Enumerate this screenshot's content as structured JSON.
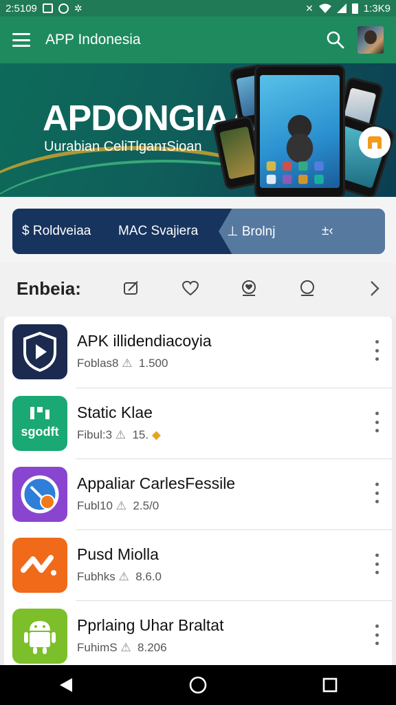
{
  "status_bar": {
    "time": "2:5109",
    "right_text": "1:3K9",
    "icons": [
      "notification-box-icon",
      "circle-app-icon",
      "settings-small-icon",
      "mute-icon",
      "wifi-icon",
      "signal-icon",
      "battery-icon"
    ]
  },
  "appbar": {
    "title": "APP Indonesia",
    "icons": [
      "menu-icon",
      "search-icon",
      "avatar"
    ]
  },
  "banner": {
    "title": "APDONGIAA",
    "subtitle": "Uurabian CeliTlganɪSioan",
    "colors": {
      "bg": "#0d6b5a",
      "accent": "#c9a331",
      "badge": "#f29b1d"
    }
  },
  "categories": {
    "items": [
      {
        "icon": "dollar-icon",
        "label": "Roldveiaa"
      },
      {
        "icon": "",
        "label": "MAC Svajiera"
      },
      {
        "icon": "download-icon",
        "label": "Brolnj"
      },
      {
        "icon": "shuffle-icon",
        "label": "±‹"
      }
    ],
    "active_index": 2,
    "colors": {
      "bg": "#17345e",
      "active": "#5679a0"
    }
  },
  "section": {
    "title": "Enbeia:",
    "icons": [
      "edit-icon",
      "heart-icon",
      "badge-heart-icon",
      "chat-icon",
      "chevron-right-icon"
    ]
  },
  "apps": [
    {
      "name": "APK illidendiacoyia",
      "meta": "Foblas8",
      "value": "1.500",
      "icon": "play-shield-icon",
      "color": "#1b2a4e"
    },
    {
      "name": "Static Klae",
      "meta": "Fibul:3",
      "value": "15.",
      "icon": "grid-green-icon",
      "color": "#1aa874"
    },
    {
      "name": "Appaliar CarlesFessile",
      "meta": "Fubl10",
      "value": "2.5/0",
      "icon": "compass-icon",
      "color": "#8a45d0"
    },
    {
      "name": "Pusd Miolla",
      "meta": "Fubhks",
      "value": "8.6.0",
      "icon": "wave-icon",
      "color": "#f06a1a"
    },
    {
      "name": "Pprlaing Uhar Braltat",
      "meta": "FuhimS",
      "value": "8.206",
      "icon": "android-icon",
      "color": "#7cbf2a"
    }
  ],
  "navbar": {
    "icons": [
      "back-icon",
      "home-icon",
      "recents-icon"
    ]
  }
}
